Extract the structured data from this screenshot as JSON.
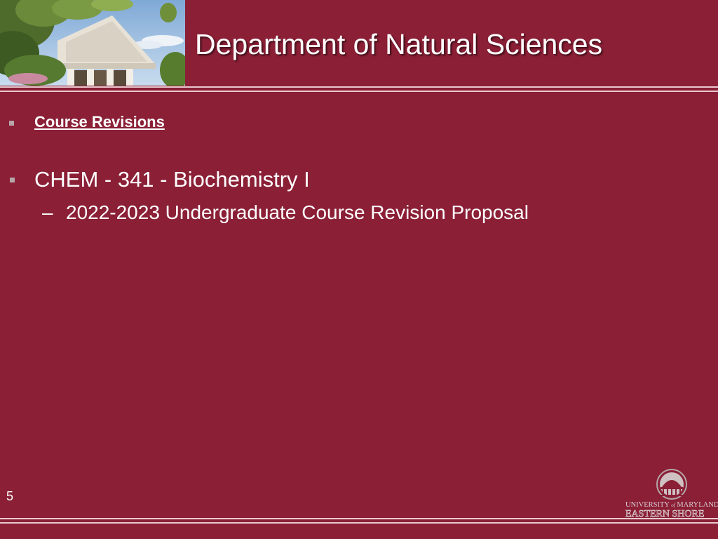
{
  "slide": {
    "title": "Department of Natural Sciences",
    "section_heading": "Course Revisions",
    "course": "CHEM - 341 - Biochemistry I",
    "sub_dash": "–",
    "sub_item": "2022-2023 Undergraduate Course Revision Proposal",
    "page_number": "5"
  },
  "logo": {
    "line1_a": "UNIVERSITY",
    "line1_of": "of",
    "line1_b": "MARYLAND",
    "line2": "EASTERN SHORE"
  },
  "colors": {
    "background": "#8a1f36",
    "rule": "#e9c9cf",
    "bullet": "#b7a6aa"
  },
  "icons": [
    "header-building-photo",
    "square-bullet-icon",
    "university-dome-logo-icon"
  ]
}
